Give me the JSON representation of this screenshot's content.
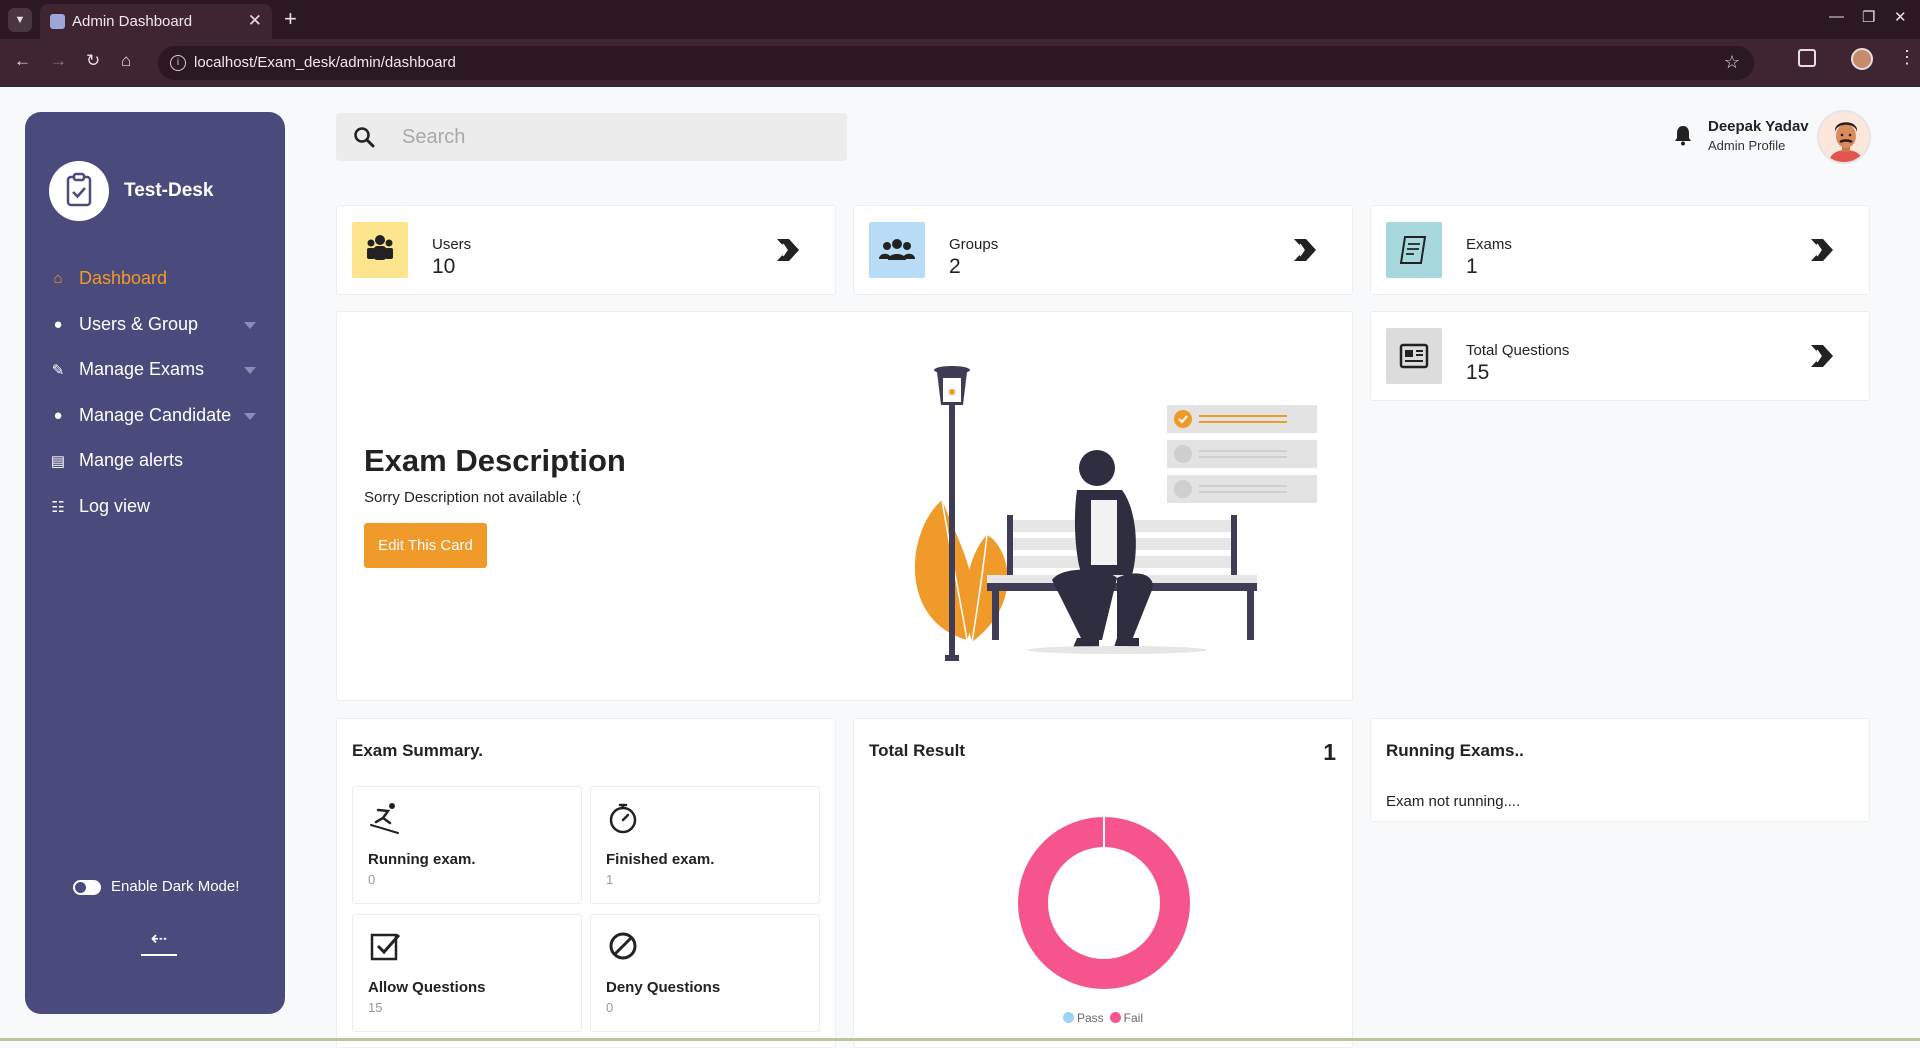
{
  "browser": {
    "tab_title": "Admin Dashboard",
    "url": "localhost/Exam_desk/admin/dashboard"
  },
  "sidebar": {
    "brand": "Test-Desk",
    "items": [
      {
        "label": "Dashboard",
        "icon": "home-icon",
        "active": true
      },
      {
        "label": "Users & Group",
        "icon": "users-icon",
        "dropdown": true
      },
      {
        "label": "Manage Exams",
        "icon": "exam-icon",
        "dropdown": true
      },
      {
        "label": "Manage Candidate",
        "icon": "candidate-icon",
        "dropdown": true
      },
      {
        "label": "Mange alerts",
        "icon": "alert-icon"
      },
      {
        "label": "Log view",
        "icon": "clipboard-icon"
      }
    ],
    "dark_mode_label": "Enable Dark Mode!",
    "dark_mode_on": false
  },
  "header": {
    "search_placeholder": "Search",
    "user_name": "Deepak Yadav",
    "user_role": "Admin Profile"
  },
  "stats": [
    {
      "label": "Users",
      "value": "10",
      "color": "#fde58e"
    },
    {
      "label": "Groups",
      "value": "2",
      "color": "#b8dcf5"
    },
    {
      "label": "Exams",
      "value": "1",
      "color": "#a6d8de"
    },
    {
      "label": "Total Questions",
      "value": "15",
      "color": "#dcdcdc"
    }
  ],
  "description": {
    "title": "Exam Description",
    "text": "Sorry Description not available :(",
    "button": "Edit This Card"
  },
  "exam_summary": {
    "title": "Exam Summary.",
    "items": [
      {
        "label": "Running exam.",
        "value": "0",
        "icon": "skiing-icon"
      },
      {
        "label": "Finished exam.",
        "value": "1",
        "icon": "stopwatch-icon"
      },
      {
        "label": "Allow Questions",
        "value": "15",
        "icon": "checkbox-icon"
      },
      {
        "label": "Deny Questions",
        "value": "0",
        "icon": "ban-icon"
      }
    ]
  },
  "total_result": {
    "title": "Total Result",
    "count": "1"
  },
  "running": {
    "title": "Running Exams..",
    "text": "Exam not running...."
  },
  "chart_data": {
    "type": "pie",
    "categories": [
      "Pass",
      "Fail"
    ],
    "values": [
      0,
      1
    ],
    "colors": [
      "#9fd0f5",
      "#f5548d"
    ],
    "legend": "bottom"
  }
}
